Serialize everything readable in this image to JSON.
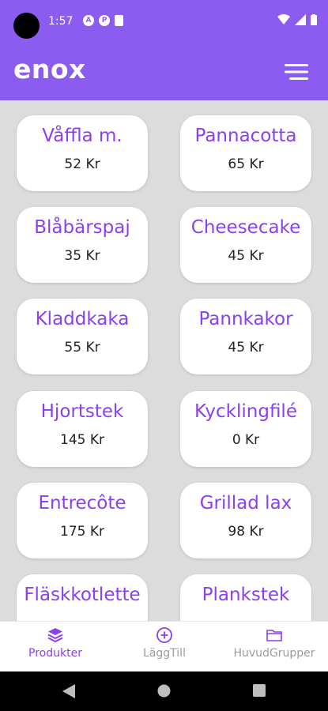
{
  "status_bar": {
    "time": "1:57",
    "notifications": [
      "A",
      "P",
      ""
    ]
  },
  "app_bar": {
    "title": "enox",
    "menu_icon": "hamburger-menu-icon"
  },
  "products": [
    {
      "name": "Våffla m.",
      "price": "52 Kr"
    },
    {
      "name": "Pannacotta",
      "price": "65 Kr"
    },
    {
      "name": "Blåbärspaj",
      "price": "35 Kr"
    },
    {
      "name": "Cheesecake",
      "price": "45 Kr"
    },
    {
      "name": "Kladdkaka",
      "price": "55 Kr"
    },
    {
      "name": "Pannkakor",
      "price": "45 Kr"
    },
    {
      "name": "Hjortstek",
      "price": "145 Kr"
    },
    {
      "name": "Kycklingfilé",
      "price": "0 Kr"
    },
    {
      "name": "Entrecôte",
      "price": "175 Kr"
    },
    {
      "name": "Grillad lax",
      "price": "98 Kr"
    },
    {
      "name": "Fläskkotlette",
      "price": ""
    },
    {
      "name": "Plankstek",
      "price": ""
    }
  ],
  "bottom_nav": {
    "items": [
      {
        "label": "Produkter",
        "icon": "layers-icon",
        "active": true
      },
      {
        "label": "LäggTill",
        "icon": "add-circle-icon",
        "active": false
      },
      {
        "label": "HuvudGrupper",
        "icon": "folder-icon",
        "active": false
      }
    ]
  },
  "colors": {
    "primary": "#8c5cf0",
    "accent_text": "#8a3ff0",
    "background": "#dcdcdc",
    "card": "#ffffff"
  }
}
